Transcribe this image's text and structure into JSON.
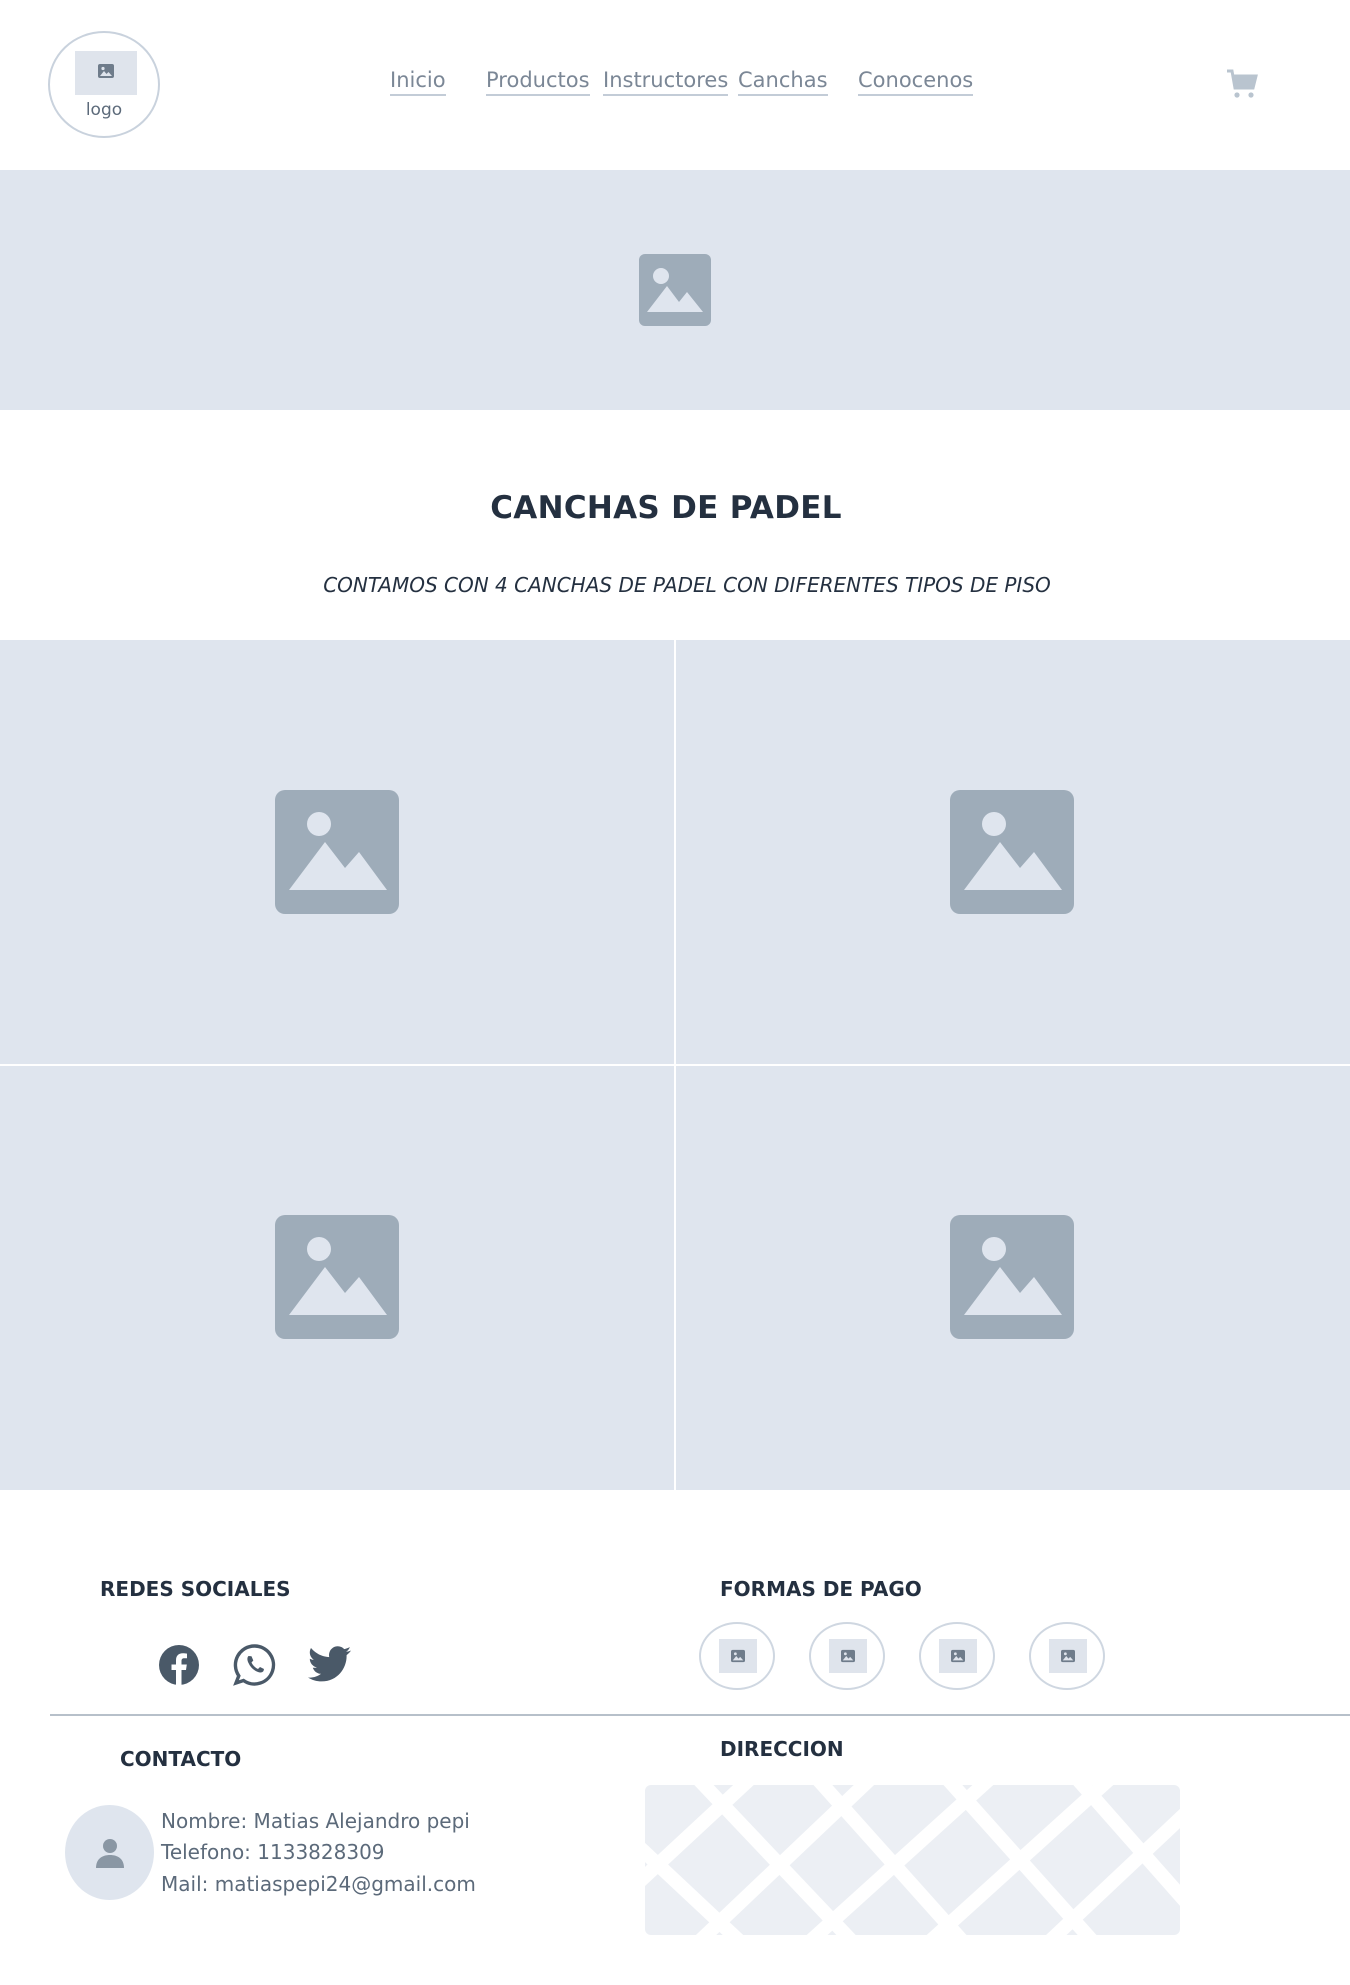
{
  "header": {
    "logo_text": "logo",
    "nav": [
      "Inicio",
      "Productos",
      "Instructores",
      "Canchas",
      "Conocenos"
    ]
  },
  "main": {
    "title": "CANCHAS DE PADEL",
    "subtitle": "CONTAMOS CON 4 CANCHAS DE PADEL CON DIFERENTES TIPOS DE PISO"
  },
  "footer": {
    "social_heading": "REDES SOCIALES",
    "payment_heading": "FORMAS DE PAGO",
    "contact_heading": "CONTACTO",
    "address_heading": "DIRECCION",
    "contact": {
      "name": "Nombre: Matias Alejandro pepi",
      "phone": "Telefono: 1133828309",
      "mail": "Mail: matiaspepi24@gmail.com"
    },
    "social_icons": [
      "facebook-icon",
      "whatsapp-icon",
      "twitter-icon"
    ]
  },
  "colors": {
    "placeholder_bg": "#dfe5ee",
    "placeholder_icon": "#9eacb9",
    "text_dark": "#243040",
    "text_muted": "#5c6a7a"
  }
}
